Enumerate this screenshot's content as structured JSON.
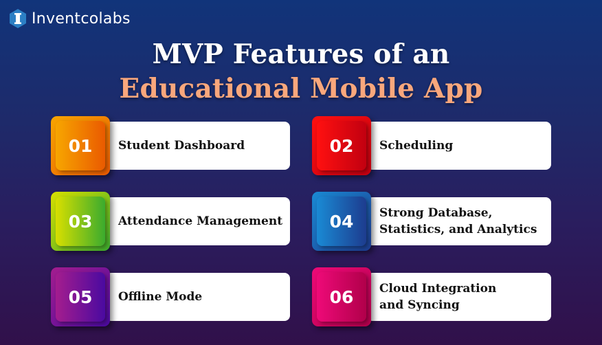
{
  "brand": {
    "name": "Inventcolabs",
    "logo_icon": "hexagon-i-logo-icon"
  },
  "title": {
    "line1": "MVP Features of an",
    "line2": "Educational Mobile App"
  },
  "colors": {
    "title_accent": "#f9a77c",
    "text": "#111111"
  },
  "features": [
    {
      "number": "01",
      "label": "Student Dashboard",
      "badge_colors": [
        "#f7a600",
        "#ea5a00"
      ]
    },
    {
      "number": "02",
      "label": "Scheduling",
      "badge_colors": [
        "#ff1010",
        "#c20010"
      ]
    },
    {
      "number": "03",
      "label": "Attendance Management",
      "badge_colors": [
        "#d8df00",
        "#3bab2e"
      ]
    },
    {
      "number": "04",
      "label": "Strong Database,\nStatistics, and Analytics",
      "badge_colors": [
        "#1a8ad4",
        "#1d3c8f"
      ]
    },
    {
      "number": "05",
      "label": "Offline Mode",
      "badge_colors": [
        "#a41d8e",
        "#4a0aa0"
      ]
    },
    {
      "number": "06",
      "label": "Cloud Integration\nand Syncing",
      "badge_colors": [
        "#ee0a78",
        "#b1004a"
      ]
    }
  ]
}
